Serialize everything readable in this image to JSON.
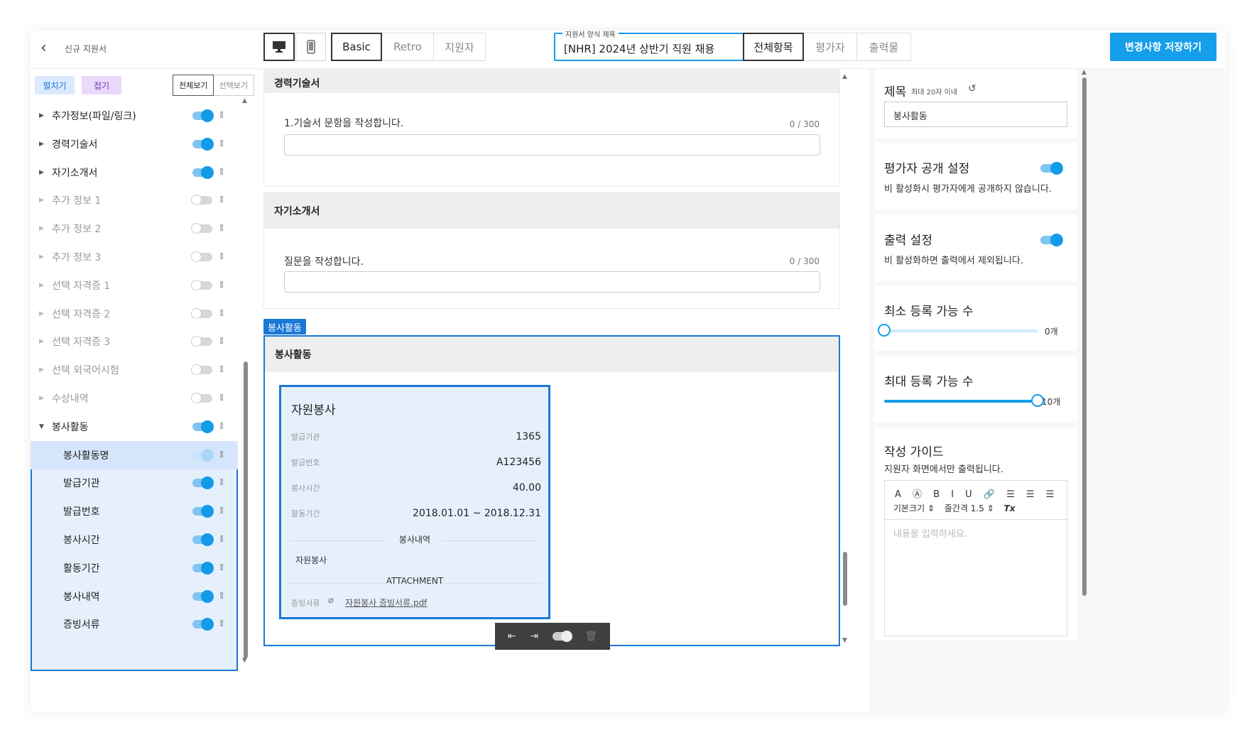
{
  "topbar": {
    "back_icon": "chevron-left-icon",
    "crumb": "신규 지원서",
    "device_desktop": "desktop-icon",
    "device_mobile": "mobile-icon",
    "styles": [
      "Basic",
      "Retro",
      "지원자"
    ],
    "title_label": "지원서 양식 제목",
    "title_value": "[NHR] 2024년 상반기 직원 채용",
    "tabs": [
      "전체항목",
      "평가자",
      "출력물"
    ],
    "save": "변경사항 저장하기"
  },
  "left": {
    "expand": "펼치기",
    "collapse": "접기",
    "view_all": "전체보기",
    "view_select": "선택보기",
    "items": [
      {
        "label": "추가정보(파일/링크)",
        "on": true
      },
      {
        "label": "경력기술서",
        "on": true
      },
      {
        "label": "자기소개서",
        "on": true
      },
      {
        "label": "추가 정보 1",
        "on": false
      },
      {
        "label": "추가 정보 2",
        "on": false
      },
      {
        "label": "추가 정보 3",
        "on": false
      },
      {
        "label": "선택 자격증 1",
        "on": false
      },
      {
        "label": "선택 자격증 2",
        "on": false
      },
      {
        "label": "선택 자격증 3",
        "on": false
      },
      {
        "label": "선택 외국어시험",
        "on": false
      },
      {
        "label": "수상내역",
        "on": false
      },
      {
        "label": "봉사활동",
        "on": true
      }
    ],
    "subitems": [
      "봉사활동명",
      "발급기관",
      "발급번호",
      "봉사시간",
      "활동기간",
      "봉사내역",
      "증빙서류"
    ]
  },
  "center": {
    "card1_header": "경력기술서",
    "card1_question": "1.기술서 문항을 작성합니다.",
    "card1_count": "0 / 300",
    "card2_header": "자기소개서",
    "card2_question": "질문을 작성합니다.",
    "card2_count": "0 / 300",
    "tag": "봉사활동",
    "card3_header": "봉사활동",
    "vcard": {
      "title": "자원봉사",
      "rows": [
        {
          "k": "발급기관",
          "v": "1365"
        },
        {
          "k": "발급번호",
          "v": "A123456"
        },
        {
          "k": "봉사시간",
          "v": "40.00"
        },
        {
          "k": "활동기간",
          "v": "2018.01.01 ~ 2018.12.31"
        }
      ],
      "section1": "봉사내역",
      "detail": "자원봉사",
      "section2": "ATTACHMENT",
      "file_label": "증빙서류",
      "file_name": "자원봉사 증빙서류.pdf"
    }
  },
  "right": {
    "title_h": "제목",
    "title_hint": "최대 20자 이내",
    "title_value": "봉사활동",
    "eval_h": "평가자 공개 설정",
    "eval_desc": "비 활성화시 평가자에게 공개하지 않습니다.",
    "print_h": "출력 설정",
    "print_desc": "비 활성화하면 출력에서 제외됩니다.",
    "min_h": "최소 등록 가능 수",
    "min_val": "0개",
    "min_level": 0,
    "max_h": "최대 등록 가능 수",
    "max_val": "10개",
    "max_level": 1,
    "guide_h": "작성 가이드",
    "guide_desc": "지원자 화면에서만 출력됩니다.",
    "toolbar1": "A Ⓐ B I U 🔗 ☰ ☰ ☰",
    "font_size": "기본크기",
    "line_height": "줄간격 1.5",
    "clear": "Tx",
    "placeholder": "내용을 입력하세요."
  },
  "colors": {
    "accent": "#159ee9",
    "select": "#1a78d6"
  }
}
